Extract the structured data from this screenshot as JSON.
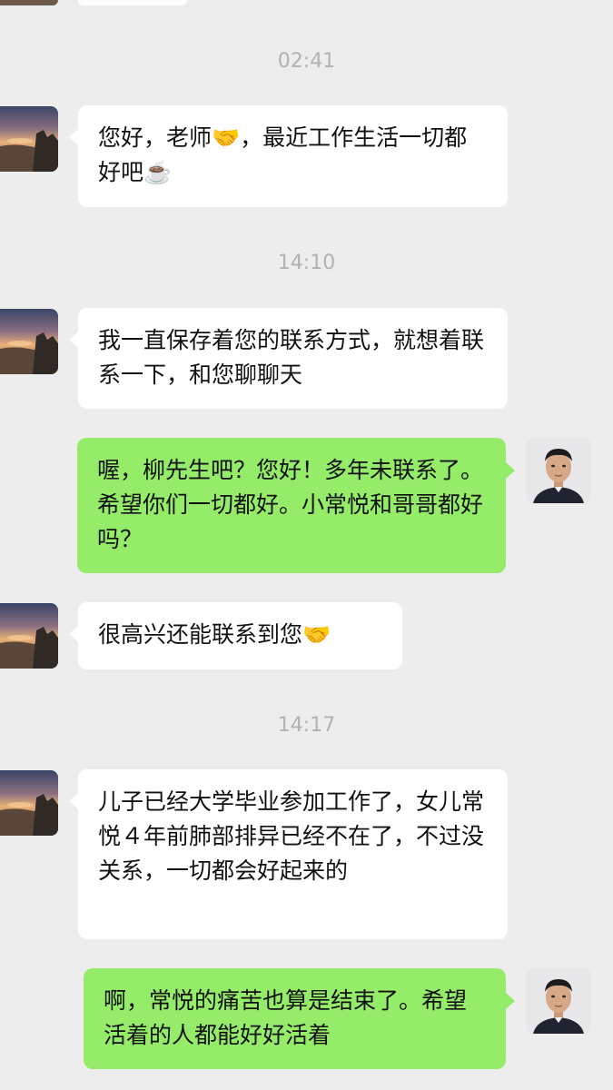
{
  "chat": {
    "timestamps": [
      "02:41",
      "14:10",
      "14:17"
    ],
    "messages": [
      {
        "side": "in",
        "text": "您好，老师🤝，最近工作生活一切都好吧☕️"
      },
      {
        "side": "in",
        "text": "我一直保存着您的联系方式，就想着联系一下，和您聊聊天"
      },
      {
        "side": "out",
        "text": "喔，柳先生吧？您好！多年未联系了。希望你们一切都好。小常悦和哥哥都好吗？"
      },
      {
        "side": "in",
        "text": "很高兴还能联系到您🤝"
      },
      {
        "side": "in",
        "text": "儿子已经大学毕业参加工作了，女儿常悦４年前肺部排异已经不在了，不过没关系，一切都会好起来的"
      },
      {
        "side": "out",
        "text": "啊，常悦的痛苦也算是结束了。希望活着的人都能好好活着"
      }
    ]
  },
  "colors": {
    "background": "#ededed",
    "incoming_bubble": "#ffffff",
    "outgoing_bubble": "#95ec69",
    "timestamp_text": "#b2b2b2"
  },
  "icons": {
    "contact_avatar": "sunset-landscape-avatar",
    "self_avatar": "man-portrait-avatar"
  }
}
